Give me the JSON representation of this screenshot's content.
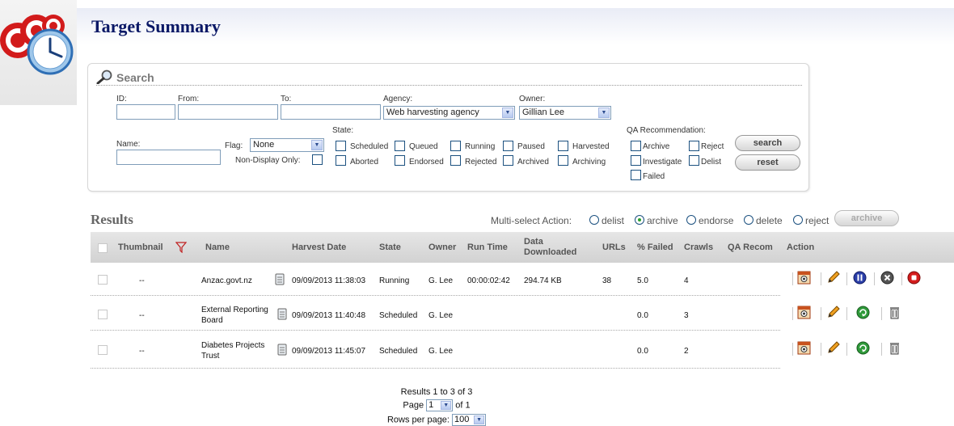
{
  "page": {
    "title": "Target Summary"
  },
  "search": {
    "title": "Search",
    "id_label": "ID:",
    "id_value": "",
    "from_label": "From:",
    "from_value": "",
    "to_label": "To:",
    "to_value": "",
    "agency_label": "Agency:",
    "agency_value": "Web harvesting agency",
    "owner_label": "Owner:",
    "owner_value": "Gillian Lee",
    "name_label": "Name:",
    "name_value": "",
    "flag_label": "Flag:",
    "flag_value": "None",
    "nondisplay_label": "Non-Display Only:",
    "state_label": "State:",
    "states": [
      "Scheduled",
      "Queued",
      "Running",
      "Paused",
      "Harvested",
      "Aborted",
      "Endorsed",
      "Rejected",
      "Archived",
      "Archiving"
    ],
    "qa_label": "QA Recommendation:",
    "qa": [
      "Archive",
      "Reject",
      "Investigate",
      "Delist",
      "Failed"
    ],
    "search_button": "search",
    "reset_button": "reset"
  },
  "results": {
    "title": "Results",
    "multi_label": "Multi-select Action:",
    "actions": [
      "delist",
      "archive",
      "endorse",
      "delete",
      "reject"
    ],
    "selected_action": "archive",
    "action_button": "archive",
    "columns": {
      "thumbnail": "Thumbnail",
      "name": "Name",
      "harvest_date": "Harvest Date",
      "state": "State",
      "owner": "Owner",
      "run_time": "Run Time",
      "data_downloaded": "Data Downloaded",
      "urls": "URLs",
      "failed": "% Failed",
      "crawls": "Crawls",
      "qa": "QA Recom",
      "action": "Action"
    },
    "rows": [
      {
        "thumbnail": "--",
        "name": "Anzac.govt.nz",
        "date": "09/09/2013 11:38:03",
        "state": "Running",
        "owner": "G. Lee",
        "run_time": "00:00:02:42",
        "data": "294.74 KB",
        "urls": "38",
        "failed": "5.0",
        "crawls": "4"
      },
      {
        "thumbnail": "--",
        "name": "External Reporting Board",
        "date": "09/09/2013 11:40:48",
        "state": "Scheduled",
        "owner": "G. Lee",
        "run_time": "",
        "data": "",
        "urls": "",
        "failed": "0.0",
        "crawls": "3"
      },
      {
        "thumbnail": "--",
        "name": "Diabetes Projects Trust",
        "date": "09/09/2013 11:45:07",
        "state": "Scheduled",
        "owner": "G. Lee",
        "run_time": "",
        "data": "",
        "urls": "",
        "failed": "0.0",
        "crawls": "2"
      }
    ],
    "summary": "Results 1 to 3 of 3",
    "page_label": "Page",
    "page_value": "1",
    "page_of": "of 1",
    "rows_label": "Rows per page:",
    "rows_value": "100"
  },
  "colors": {
    "title": "#0a1866",
    "row_dots": "#aaaaaa",
    "radio_selected": "#2aa12a"
  },
  "icons": [
    "target-clock-logo",
    "magnifier-icon",
    "flag-filter-icon",
    "log-icon",
    "view-icon",
    "edit-icon",
    "pause-icon",
    "abort-icon",
    "stop-icon",
    "run-icon",
    "delete-icon"
  ]
}
